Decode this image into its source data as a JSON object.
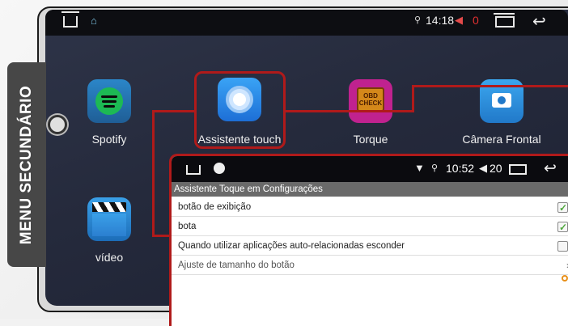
{
  "side_tab": {
    "label": "MENU SECUNDÁRIO"
  },
  "statusbar": {
    "time": "14:18",
    "volume": "0"
  },
  "apps": [
    {
      "label": "Spotify",
      "icon": "spotify-icon"
    },
    {
      "label": "Assistente touch",
      "icon": "assistive-touch-icon"
    },
    {
      "label": "Torque",
      "icon": "torque-obd-icon"
    },
    {
      "label": "Câmera Frontal",
      "icon": "camera-icon"
    },
    {
      "label": "vídeo",
      "icon": "video-clapper-icon"
    }
  ],
  "torque_icon_text": [
    "OBD",
    "CHECK"
  ],
  "panel": {
    "status": {
      "time": "10:52",
      "volume": "20"
    },
    "title": "Assistente Toque em Configurações",
    "rows": [
      {
        "label": "botão de exibição",
        "checked": true
      },
      {
        "label": "bota",
        "checked": true
      },
      {
        "label": "Quando utilizar aplicações auto-relacionadas esconder",
        "checked": false
      },
      {
        "label": "Ajuste de tamanho do botão",
        "chevron": "›"
      }
    ]
  },
  "colors": {
    "highlight": "#b01a1a",
    "side_tab": "#474747",
    "screen_bg": "#272c3e"
  }
}
